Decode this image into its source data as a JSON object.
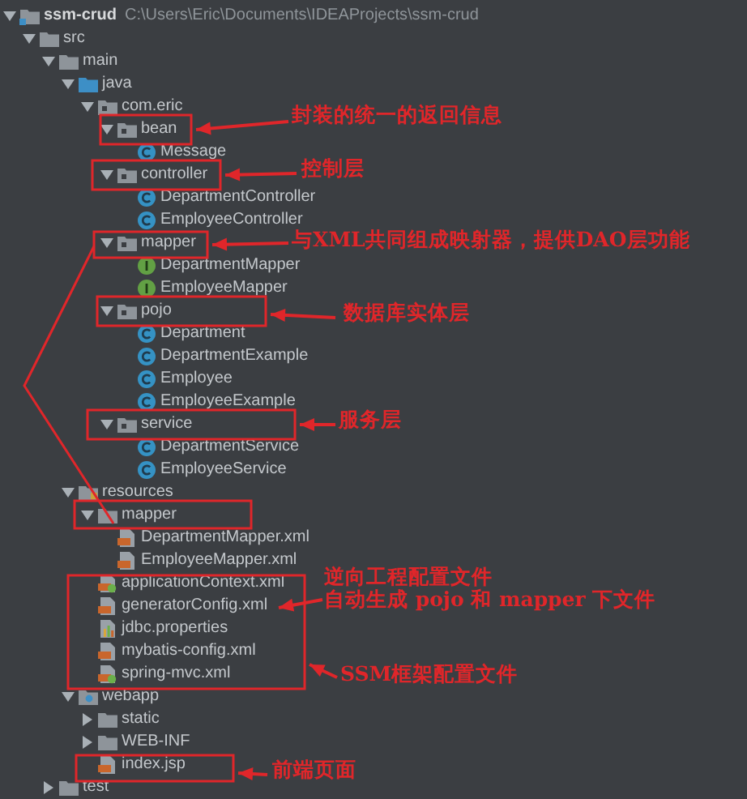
{
  "project_tree": [
    {
      "name": "ssm-crud",
      "path": "C:\\Users\\Eric\\Documents\\IDEAProjects\\ssm-crud",
      "kind": "module",
      "expanded": true,
      "children": [
        {
          "name": "src",
          "kind": "folder",
          "expanded": true,
          "children": [
            {
              "name": "main",
              "kind": "folder",
              "expanded": true,
              "children": [
                {
                  "name": "java",
                  "kind": "source_root",
                  "expanded": true,
                  "children": [
                    {
                      "name": "com.eric",
                      "kind": "package",
                      "expanded": true,
                      "children": [
                        {
                          "name": "bean",
                          "kind": "package",
                          "expanded": true,
                          "children": [
                            {
                              "name": "Message",
                              "kind": "class"
                            }
                          ]
                        },
                        {
                          "name": "controller",
                          "kind": "package",
                          "expanded": true,
                          "children": [
                            {
                              "name": "DepartmentController",
                              "kind": "class"
                            },
                            {
                              "name": "EmployeeController",
                              "kind": "class"
                            }
                          ]
                        },
                        {
                          "name": "mapper",
                          "kind": "package",
                          "expanded": true,
                          "children": [
                            {
                              "name": "DepartmentMapper",
                              "kind": "interface"
                            },
                            {
                              "name": "EmployeeMapper",
                              "kind": "interface"
                            }
                          ]
                        },
                        {
                          "name": "pojo",
                          "kind": "package",
                          "expanded": true,
                          "children": [
                            {
                              "name": "Department",
                              "kind": "class"
                            },
                            {
                              "name": "DepartmentExample",
                              "kind": "class"
                            },
                            {
                              "name": "Employee",
                              "kind": "class"
                            },
                            {
                              "name": "EmployeeExample",
                              "kind": "class"
                            }
                          ]
                        },
                        {
                          "name": "service",
                          "kind": "package",
                          "expanded": true,
                          "children": [
                            {
                              "name": "DepartmentService",
                              "kind": "class"
                            },
                            {
                              "name": "EmployeeService",
                              "kind": "class"
                            }
                          ]
                        }
                      ]
                    }
                  ]
                },
                {
                  "name": "resources",
                  "kind": "resources_root",
                  "expanded": true,
                  "children": [
                    {
                      "name": "mapper",
                      "kind": "folder",
                      "expanded": true,
                      "children": [
                        {
                          "name": "DepartmentMapper.xml",
                          "kind": "xml"
                        },
                        {
                          "name": "EmployeeMapper.xml",
                          "kind": "xml"
                        }
                      ]
                    },
                    {
                      "name": "applicationContext.xml",
                      "kind": "spring_xml"
                    },
                    {
                      "name": "generatorConfig.xml",
                      "kind": "xml"
                    },
                    {
                      "name": "jdbc.properties",
                      "kind": "properties"
                    },
                    {
                      "name": "mybatis-config.xml",
                      "kind": "xml"
                    },
                    {
                      "name": "spring-mvc.xml",
                      "kind": "spring_xml"
                    }
                  ]
                },
                {
                  "name": "webapp",
                  "kind": "web_root",
                  "expanded": true,
                  "children": [
                    {
                      "name": "static",
                      "kind": "folder",
                      "expanded": false
                    },
                    {
                      "name": "WEB-INF",
                      "kind": "folder",
                      "expanded": false
                    },
                    {
                      "name": "index.jsp",
                      "kind": "jsp"
                    }
                  ]
                }
              ]
            },
            {
              "name": "test",
              "kind": "folder",
              "expanded": false
            }
          ]
        }
      ]
    }
  ],
  "annotations": [
    {
      "lines": [
        "封装的统一的返回信息"
      ]
    },
    {
      "lines": [
        "控制层"
      ]
    },
    {
      "lines": [
        "与XML共同组成映射器，提供DAO层功能"
      ]
    },
    {
      "lines": [
        "数据库实体层"
      ]
    },
    {
      "lines": [
        "服务层"
      ]
    },
    {
      "lines": [
        "逆向工程配置文件",
        "自动生成 pojo 和 mapper 下文件"
      ]
    },
    {
      "lines": [
        "SSM框架配置文件"
      ]
    },
    {
      "lines": [
        "前端页面"
      ]
    }
  ]
}
